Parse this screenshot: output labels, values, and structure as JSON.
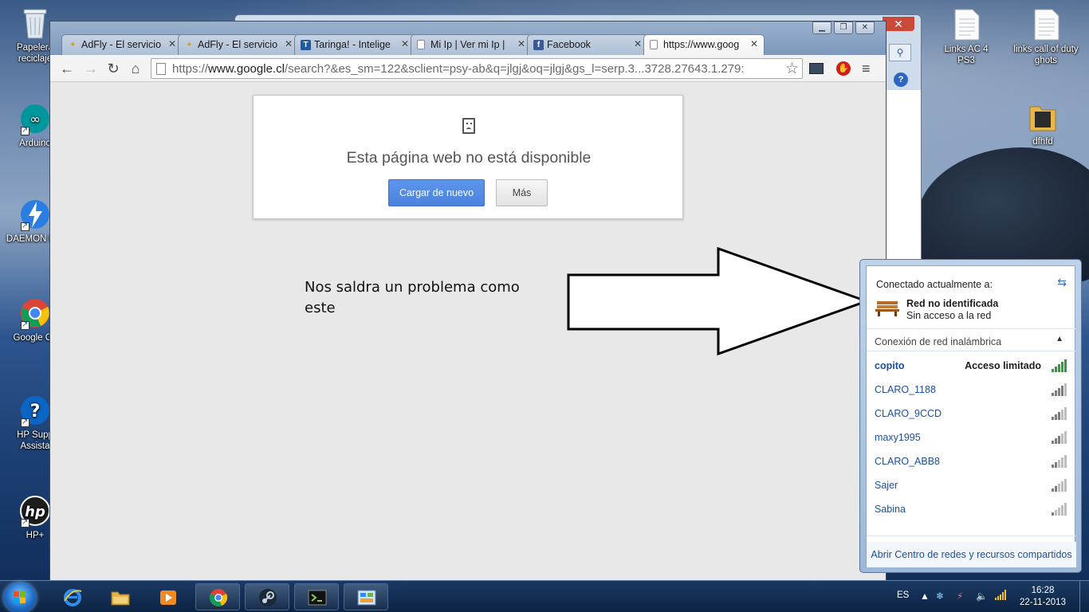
{
  "desktop": {
    "left_icons": [
      {
        "label": "Papelera reciclaje",
        "icon": "recycle-bin-icon"
      },
      {
        "label": "Arduino",
        "icon": "arduino-icon"
      },
      {
        "label": "DAEMON Lite",
        "icon": "daemon-tools-icon"
      },
      {
        "label": "Google Ch",
        "icon": "chrome-icon"
      },
      {
        "label": "HP Supp Assista",
        "icon": "hp-support-icon"
      },
      {
        "label": "HP+",
        "icon": "hp-icon"
      }
    ],
    "right_icons": [
      {
        "label": "Links AC 4 PS3",
        "icon": "text-file-icon"
      },
      {
        "label": "links call of duty ghots",
        "icon": "text-file-icon"
      },
      {
        "label": "dfhfd",
        "icon": "folder-icon"
      }
    ]
  },
  "browser": {
    "tabs": [
      {
        "label": "AdFly - El servicio",
        "icon": "adfly-icon",
        "color": "#c9a227"
      },
      {
        "label": "AdFly - El servicio",
        "icon": "adfly-icon",
        "color": "#c9a227"
      },
      {
        "label": "Taringa! - Intelige",
        "icon": "taringa-icon",
        "color": "#1f5aa0"
      },
      {
        "label": "Mi Ip | Ver mi Ip |",
        "icon": "page-icon",
        "color": "#888888"
      },
      {
        "label": "Facebook",
        "icon": "facebook-icon",
        "color": "#3b5998"
      },
      {
        "label": "https://www.goog",
        "icon": "page-icon",
        "color": "#888888"
      }
    ],
    "url_prefix": "https://",
    "url_host": "www.google.cl",
    "url_rest": "/search?&es_sm=122&sclient=psy-ab&q=jlgj&oq=jlgj&gs_l=serp.3...3728.27643.1.279:",
    "error": {
      "title": "Esta página web no está disponible",
      "reload_label": "Cargar de nuevo",
      "more_label": "Más"
    }
  },
  "annotation": {
    "line1": "Nos saldra un problema como",
    "line2": "este"
  },
  "network_flyout": {
    "connected_label": "Conectado actualmente a:",
    "current_network": "Red no identificada",
    "current_status": "Sin acceso a la red",
    "section_title": "Conexión de red inalámbrica",
    "networks": [
      {
        "ssid": "copito",
        "status": "Acceso limitado",
        "connected": true
      },
      {
        "ssid": "CLARO_1188",
        "status": "",
        "connected": false
      },
      {
        "ssid": "CLARO_9CCD",
        "status": "",
        "connected": false
      },
      {
        "ssid": "maxy1995",
        "status": "",
        "connected": false
      },
      {
        "ssid": "CLARO_ABB8",
        "status": "",
        "connected": false
      },
      {
        "ssid": "Sajer",
        "status": "",
        "connected": false
      },
      {
        "ssid": "Sabina",
        "status": "",
        "connected": false
      }
    ],
    "footer_link": "Abrir Centro de redes y recursos compartidos"
  },
  "taskbar": {
    "pinned": [
      "internet-explorer-icon",
      "file-explorer-icon",
      "media-player-icon",
      "chrome-icon",
      "steam-icon",
      "terminal-icon",
      "control-panel-icon"
    ],
    "language": "ES",
    "time": "16:28",
    "date": "22-11-2013"
  },
  "colors": {
    "reload_button": "#4a82dd",
    "link_blue": "#1d4f9a",
    "signal_green": "#2f9e3a"
  }
}
